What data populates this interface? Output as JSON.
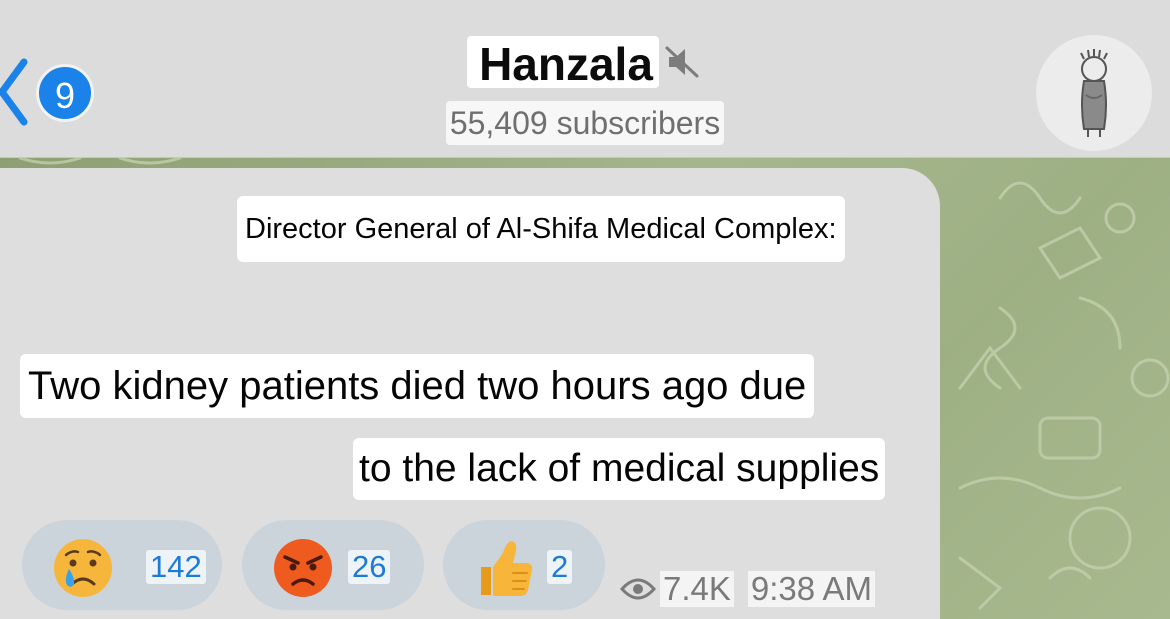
{
  "header": {
    "back_badge_count": "9",
    "channel_name": "Hanzala",
    "subscribers": "55,409 subscribers",
    "muted_icon": "speaker-muted-icon",
    "avatar_icon": "handala-figure-avatar"
  },
  "message": {
    "lines": [
      "Director General of Al-Shifa Medical Complex:",
      "Two kidney patients died two hours ago due",
      "to the lack of medical supplies"
    ],
    "reactions": [
      {
        "emoji": "crying-face",
        "count": "142"
      },
      {
        "emoji": "angry-face",
        "count": "26"
      },
      {
        "emoji": "thumbs-up",
        "count": "2"
      }
    ],
    "views": "7.4K",
    "time": "9:38 AM"
  },
  "colors": {
    "accent": "#1a82e8",
    "reaction_bg": "#cbd3db",
    "reaction_count": "#1c7bd9",
    "bubble": "#dedede",
    "header": "#dcdcdc",
    "wallpaper": "#a6b68d"
  }
}
